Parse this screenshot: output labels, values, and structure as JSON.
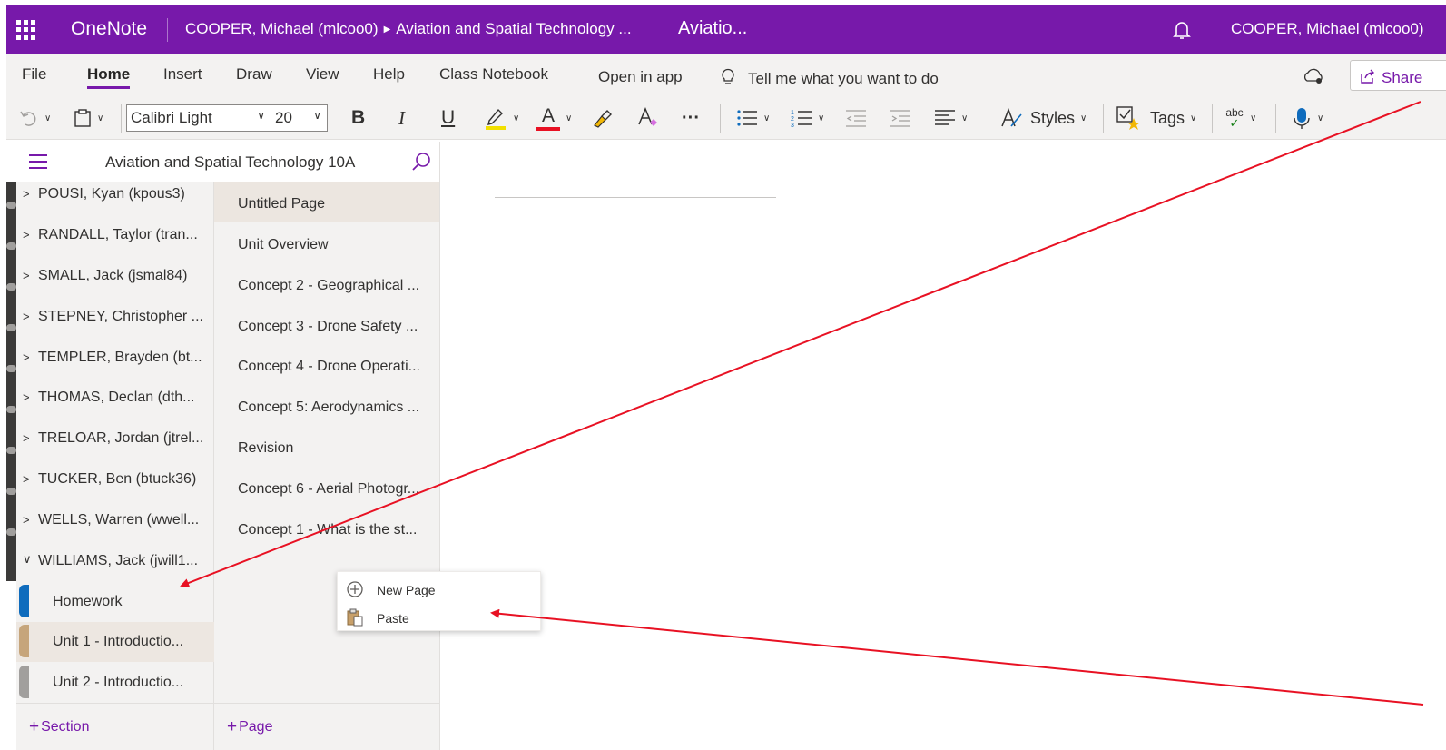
{
  "titlebar": {
    "app_name": "OneNote",
    "breadcrumb_user": "COOPER, Michael (mlcoo0)",
    "breadcrumb_notebook": "Aviation and Spatial Technology ...",
    "page_title": "Aviatio...",
    "user_name": "COOPER, Michael (mlcoo0)"
  },
  "ribbon_tabs": {
    "file": "File",
    "home": "Home",
    "insert": "Insert",
    "draw": "Draw",
    "view": "View",
    "help": "Help",
    "class_notebook": "Class Notebook",
    "open_in_app": "Open in app",
    "tell_me": "Tell me what you want to do",
    "share": "Share"
  },
  "toolbar": {
    "font_name": "Calibri Light",
    "font_size": "20",
    "bold": "B",
    "italic": "I",
    "underline": "U",
    "font_color_glyph": "A",
    "more": "···",
    "styles": "Styles",
    "tags": "Tags",
    "spell_glyph": "abc",
    "highlight_color": "#f2e000",
    "font_color": "#e81123"
  },
  "nav": {
    "notebook_title": "Aviation and Spatial Technology 10A"
  },
  "section_groups": [
    "POUSI, Kyan (kpous3)",
    "RANDALL, Taylor (tran...",
    "SMALL, Jack (jsmal84)",
    "STEPNEY, Christopher ...",
    "TEMPLER, Brayden (bt...",
    "THOMAS, Declan (dth...",
    "TRELOAR, Jordan (jtrel...",
    "TUCKER, Ben (btuck36)",
    "WELLS, Warren (wwell...",
    "WILLIAMS, Jack (jwill1..."
  ],
  "sections": [
    {
      "label": "Homework",
      "color": "#0f6cbd"
    },
    {
      "label": "Unit 1 - Introductio...",
      "color": "#c6a57b"
    },
    {
      "label": "Unit 2 - Introductio...",
      "color": "#a19f9d"
    }
  ],
  "pages": [
    "Untitled Page",
    "Unit Overview",
    "Concept 2 - Geographical ...",
    "Concept 3 - Drone Safety ...",
    "Concept 4 - Drone Operati...",
    "Concept 5: Aerodynamics ...",
    "Revision",
    "Concept 6 - Aerial Photogr...",
    "Concept 1 - What is the st..."
  ],
  "bottom": {
    "add_section": "Section",
    "add_page": "Page"
  },
  "context_menu": {
    "new_page": "New Page",
    "paste": "Paste"
  },
  "colors": {
    "brand": "#7719aa",
    "annotation_arrow": "#e81123"
  }
}
